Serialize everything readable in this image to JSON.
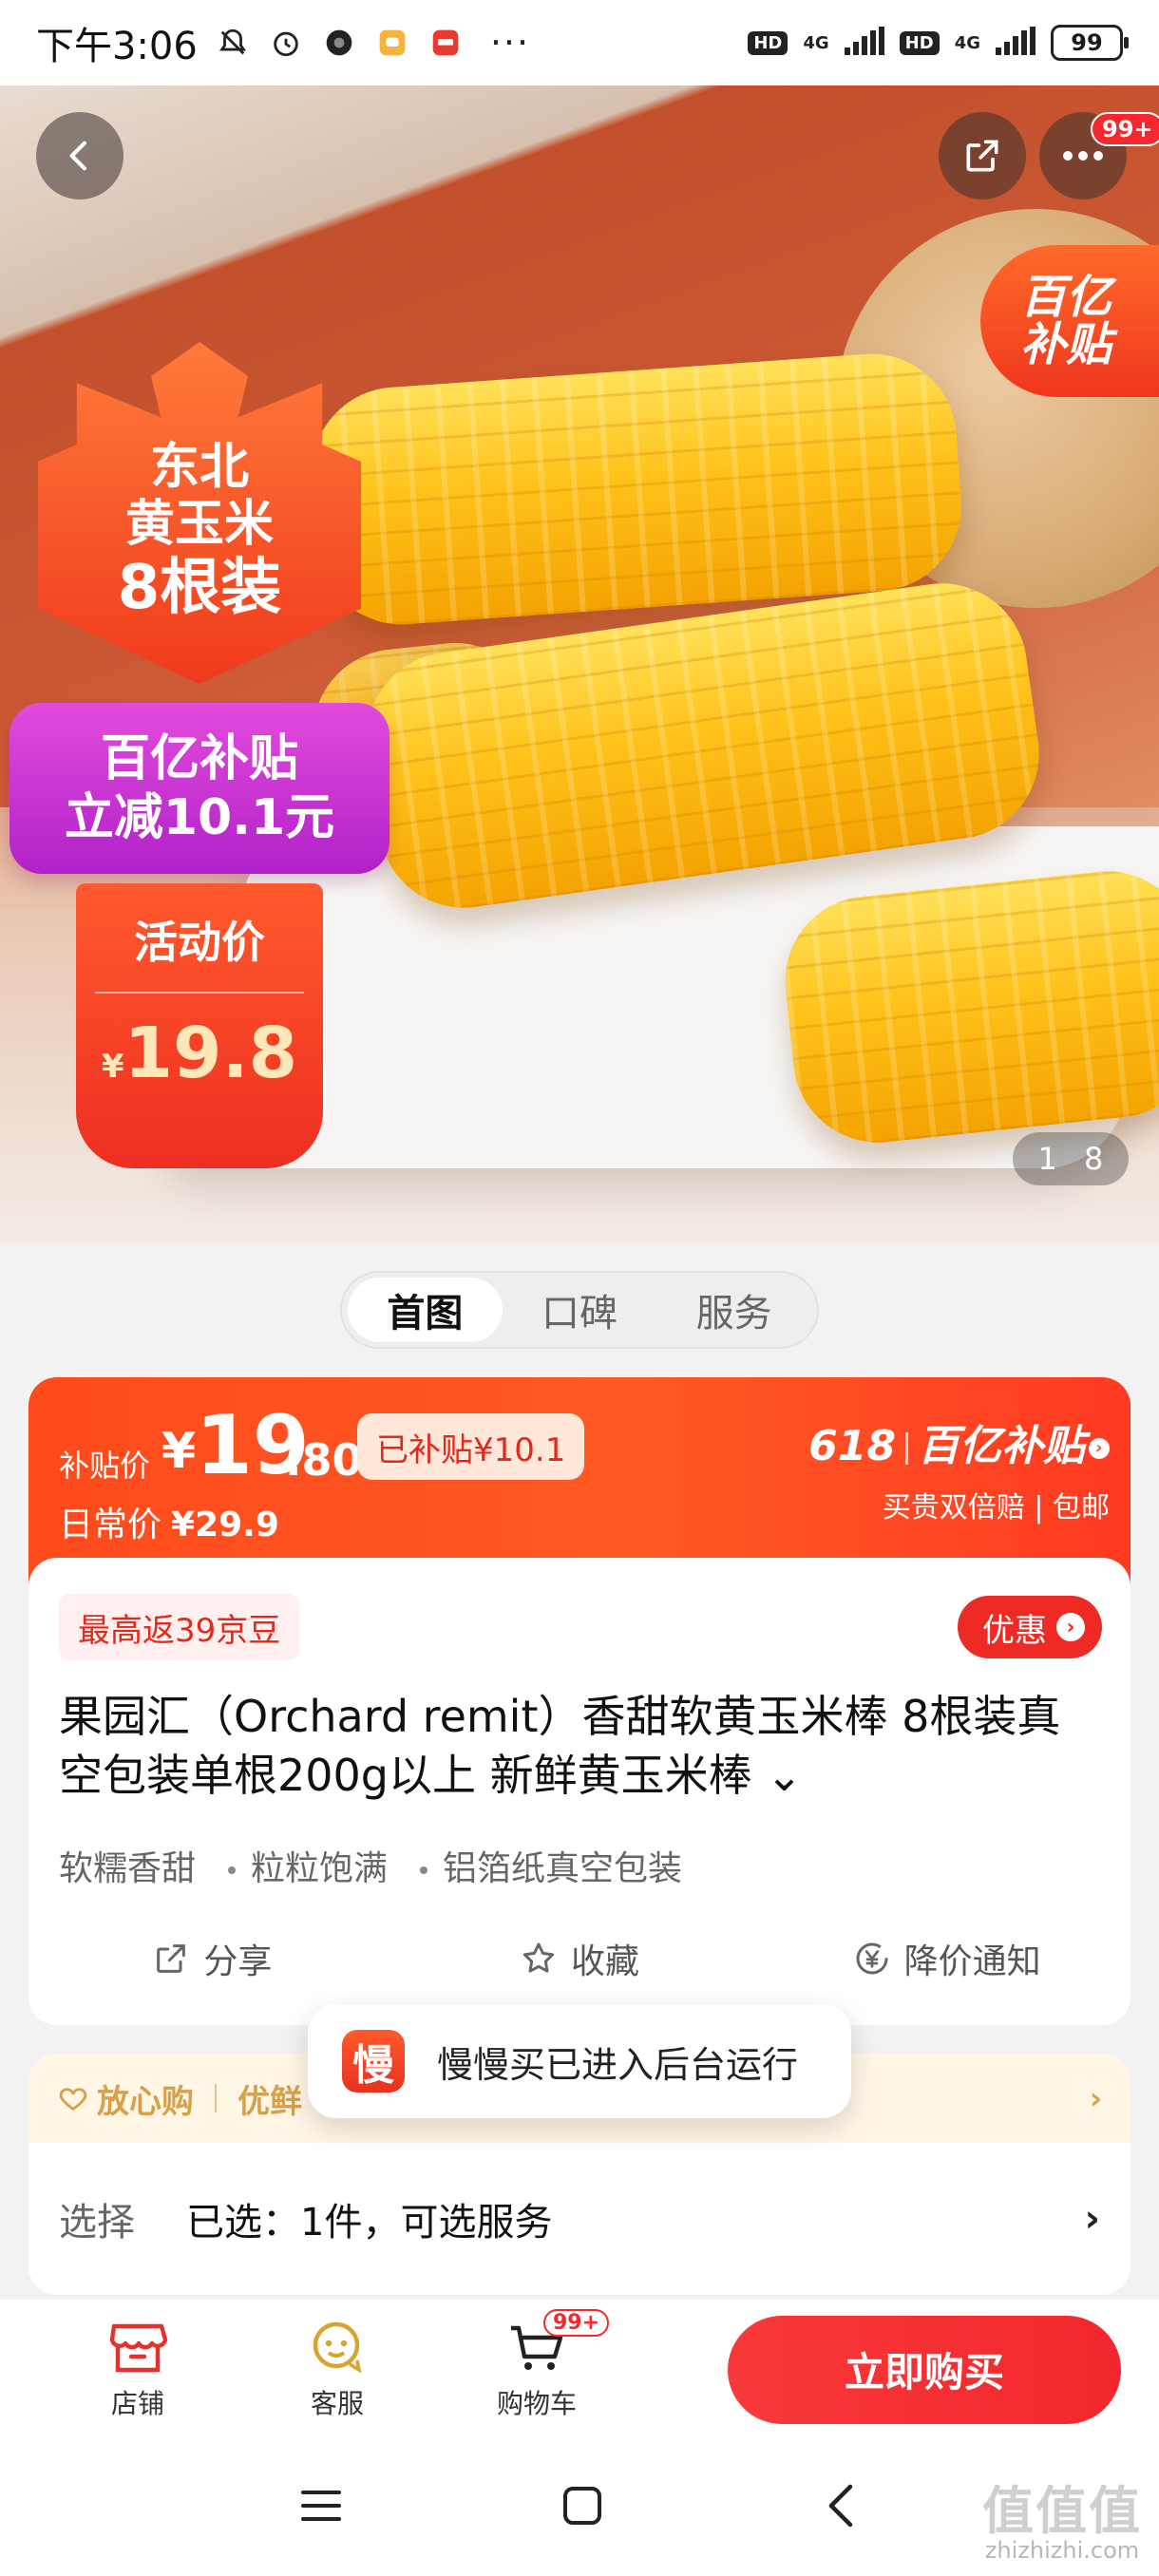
{
  "status_bar": {
    "time": "下午3:06",
    "network_1": "4G",
    "network_2": "4G",
    "hd_label": "HD",
    "battery": "99",
    "more_dots": "···"
  },
  "hero": {
    "more_badge": "99+",
    "subsidy_corner": [
      "百亿",
      "补贴"
    ],
    "promo_lines": [
      "东北",
      "黄玉米",
      "8根装"
    ],
    "promo_subsidy": [
      "百亿补贴",
      "立减10.1元"
    ],
    "promo_activity": "活动价",
    "promo_currency": "¥",
    "promo_price": "19.8",
    "page_current": "1",
    "page_total": "8"
  },
  "tabs": [
    {
      "label": "首图",
      "active": true
    },
    {
      "label": "口碑",
      "active": false
    },
    {
      "label": "服务",
      "active": false
    }
  ],
  "price_banner": {
    "label": "补贴价",
    "currency": "¥",
    "price_int": "19",
    "price_dec": ".80",
    "subsidized": "已补贴¥10.1",
    "regular_label": "日常价",
    "regular_price": "¥29.9",
    "campaign_618": "618",
    "campaign_name": "百亿补贴",
    "guarantee": "买贵双倍赔 | 包邮"
  },
  "product": {
    "beans": "最高返39京豆",
    "coupon": "优惠",
    "title": "果园汇（Orchard remit）香甜软黄玉米棒 8根装真空包装单根200g以上 新鲜黄玉米棒 ⌄",
    "features": [
      "软糯香甜",
      "粒粒饱满",
      "铝箔纸真空包装"
    ],
    "actions": {
      "share": "分享",
      "favorite": "收藏",
      "price_alert": "降价通知"
    }
  },
  "assurance": {
    "label": "放心购",
    "text": "优鲜",
    "more": "›"
  },
  "select": {
    "label": "选择",
    "value": "已选：1件，可选服务",
    "arrow": "›"
  },
  "toast": {
    "icon_char": "慢",
    "text": "慢慢买已进入后台运行"
  },
  "bottom_bar": {
    "store": "店铺",
    "service": "客服",
    "cart": "购物车",
    "cart_badge": "99+",
    "buy": "立即购买"
  },
  "watermark": {
    "brand": "值值值",
    "url": "zhizhizhi.com"
  },
  "colors": {
    "accent_red": "#f2272c",
    "banner_orange": "#ff4a1c",
    "gold": "#d7a04a"
  }
}
